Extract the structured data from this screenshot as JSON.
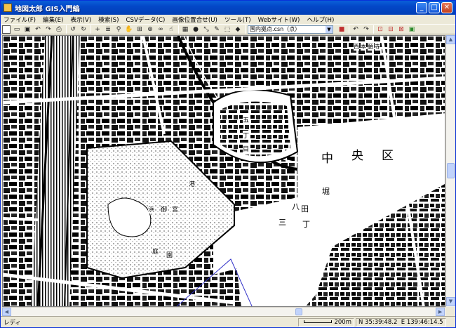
{
  "window": {
    "title": "地図太郎 GIS入門編",
    "controls": {
      "minimize": "_",
      "maximize": "□",
      "close": "✕"
    }
  },
  "menu": [
    "ファイル(F)",
    "編集(E)",
    "表示(V)",
    "検索(S)",
    "CSVデータ(C)",
    "画像位置合せ(U)",
    "ツール(T)",
    "Webサイト(W)",
    "ヘルプ(H)"
  ],
  "toolbar": {
    "layer_select": {
      "value": "国内拠点.csn（点）"
    },
    "icons": [
      "new-icon",
      "open-icon",
      "save-icon",
      "undo-icon",
      "redo-icon",
      "print-icon",
      "back-icon",
      "forward-icon",
      "add-icon",
      "layers-icon",
      "zoom-icon",
      "pan-icon",
      "full-extent-icon",
      "find-icon",
      "hand-icon",
      "table-icon",
      "info-icon",
      "measure-icon",
      "draw-line-icon",
      "select-icon"
    ]
  },
  "map": {
    "labels": [
      "中",
      "央",
      "区",
      "五",
      "丁",
      "目",
      "八",
      "丁",
      "堀",
      "三",
      "田",
      "港",
      "浜",
      "御",
      "宮",
      "庭",
      "園",
      "西",
      "本",
      "願",
      "寺"
    ],
    "overlay_color": "#3030c8"
  },
  "status": {
    "ready": "レディ",
    "scale": "200m",
    "coords": "N 35:39:48.2",
    "coords_e": "E 139:46:14.5"
  }
}
